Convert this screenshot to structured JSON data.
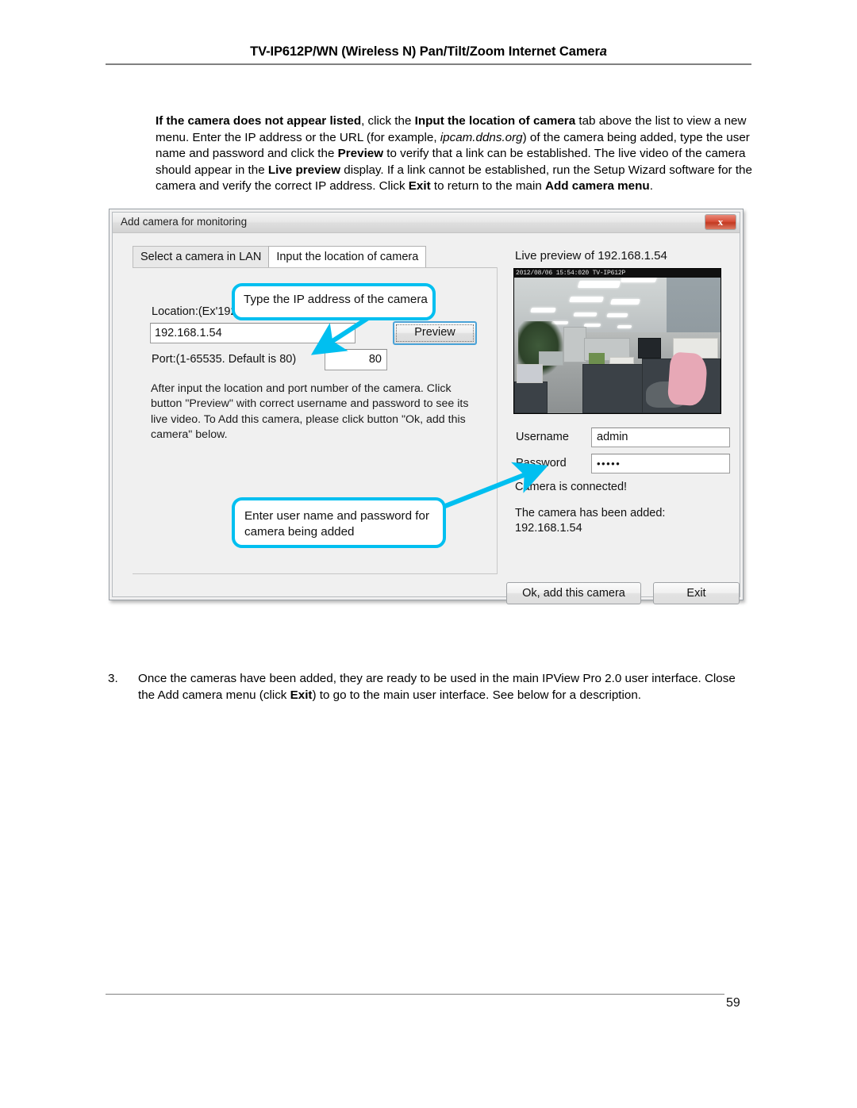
{
  "header": {
    "title_main": "TV-IP612P/WN (Wireless N) Pan/Tilt/Zoom Internet Camer",
    "title_tail": "a"
  },
  "intro": {
    "b1": "If the camera does not appear listed",
    "t1": ", click the ",
    "b2": "Input the location of camera",
    "t2": " tab above the list to view a new menu. Enter the IP address or the URL (for example, ",
    "i1": "ipcam.ddns.org",
    "t3": ") of the camera being added, type the user name and password and click the ",
    "b3": "Preview",
    "t4": " to verify that a link can be established. The live video of the camera should appear in the ",
    "b4": "Live preview",
    "t5": " display. If a link cannot be established, run the Setup Wizard software for the camera and verify the correct IP address. Click ",
    "b5": "Exit",
    "t6": " to return to the main ",
    "b6": "Add camera menu",
    "t7": "."
  },
  "dialog": {
    "title": "Add camera for monitoring",
    "close_label": "x",
    "tabs": [
      {
        "label": "Select a camera in LAN",
        "active": false
      },
      {
        "label": "Input the location of camera",
        "active": true
      }
    ],
    "location_label": "Location:(Ex'192.168.0.1' or 'ipcam.ddns.org')",
    "location_value": "192.168.1.54",
    "preview_button": "Preview",
    "port_label": "Port:(1-65535. Default is 80)",
    "port_value": "80",
    "help_text": "After input the location and port number of the camera. Click button \"Preview\" with correct username and password to see its live video. To Add this camera, please click button \"Ok, add this camera\" below.",
    "live_preview_label": "Live preview of 192.168.1.54",
    "video_timestamp": "2012/08/06 15:54:020  TV-IP612P",
    "username_label": "Username",
    "username_value": "admin",
    "password_label": "Password",
    "password_value": "•••••",
    "status_connected": "Camera is connected!",
    "status_added_line1": "The camera has been added:",
    "status_added_line2": "192.168.1.54",
    "ok_button": "Ok, add this camera",
    "exit_button": "Exit"
  },
  "callouts": {
    "one": "Type the IP address of the camera",
    "two_line1": "Enter user name and password for",
    "two_line2": "camera being added",
    "color": "#00bff0"
  },
  "step3": {
    "number": "3.",
    "t1": "Once the cameras have been added, they are ready to be used in the main IPView Pro 2.0 user interface. Close the Add camera menu (click ",
    "b1": "Exit",
    "t2": ") to go to the main user interface. See below for a description."
  },
  "footer": {
    "page_number": "59"
  }
}
